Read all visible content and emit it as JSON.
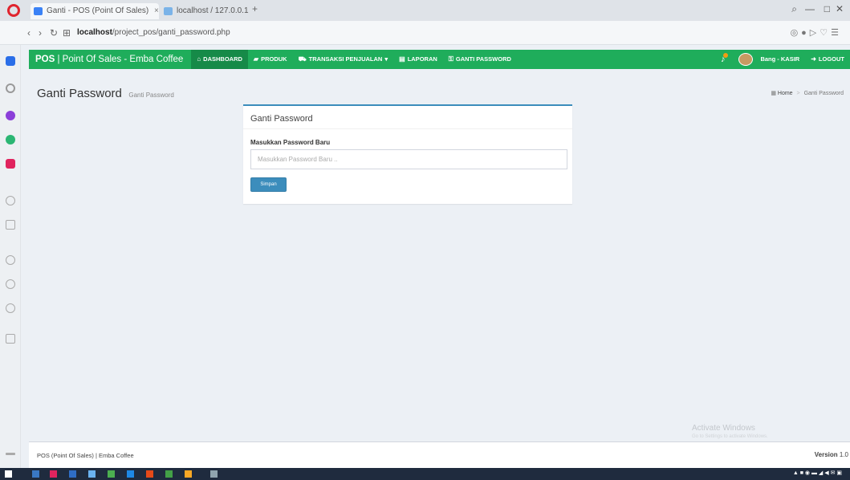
{
  "browser": {
    "tabs": [
      {
        "label": "Ganti - POS (Point Of Sales)"
      },
      {
        "label": "localhost / 127.0.0.1"
      }
    ],
    "url_host": "localhost",
    "url_path": "/project_pos/ganti_password.php"
  },
  "navbar": {
    "brand_bold": "POS",
    "brand_rest": " | Point Of Sales - Emba Coffee",
    "items": [
      {
        "label": "DASHBOARD",
        "icon": "home-icon"
      },
      {
        "label": "PRODUK",
        "icon": "folder-icon"
      },
      {
        "label": "TRANSAKSI PENJUALAN",
        "icon": "cart-icon",
        "caret": "▾"
      },
      {
        "label": "LAPORAN",
        "icon": "document-icon"
      },
      {
        "label": "GANTI PASSWORD",
        "icon": "lock-icon"
      }
    ],
    "user_label": "Bang - KASIR",
    "logout_label": "LOGOUT"
  },
  "content_header": {
    "title": "Ganti Password",
    "subtitle": "Ganti Password"
  },
  "breadcrumb": {
    "home": "Home",
    "current": "Ganti Password"
  },
  "card": {
    "title": "Ganti Password",
    "field_label": "Masukkan Password Baru",
    "field_placeholder": "Masukkan Password Baru ..",
    "submit_label": "Simpan"
  },
  "watermark": {
    "title": "Activate Windows",
    "subtitle": "Go to Settings to activate Windows."
  },
  "footer": {
    "text": "POS (Point Of Sales) | Emba Coffee",
    "version_label": "Version",
    "version_value": " 1.0"
  },
  "colors": {
    "navbar_green": "#1fad5b",
    "navbar_active": "#168a48",
    "card_accent": "#3c8dbc",
    "button_blue": "#3c8dbc",
    "page_bg": "#ecf0f5"
  }
}
